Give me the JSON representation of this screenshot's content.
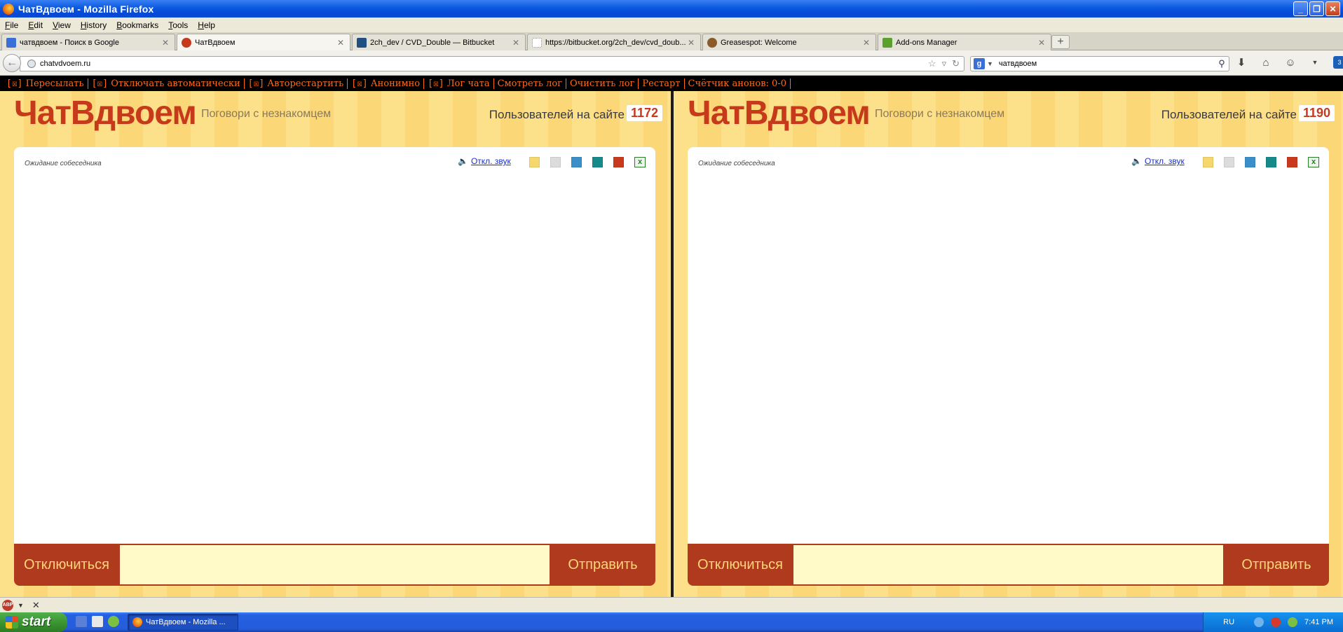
{
  "window": {
    "title": "ЧатВдвоем - Mozilla Firefox"
  },
  "menu": [
    "File",
    "Edit",
    "View",
    "History",
    "Bookmarks",
    "Tools",
    "Help"
  ],
  "tabs": [
    {
      "label": "чатвдвоем - Поиск в Google",
      "icon_color": "#3b6fd8",
      "active": false
    },
    {
      "label": "ЧатВдвоем",
      "icon_color": "#c6391b",
      "active": true
    },
    {
      "label": "2ch_dev / CVD_Double — Bitbucket",
      "icon_color": "#205081",
      "active": false
    },
    {
      "label": "https://bitbucket.org/2ch_dev/cvd_doub...",
      "icon_color": "#cccccc",
      "active": false
    },
    {
      "label": "Greasespot: Welcome",
      "icon_color": "#8a5a2b",
      "active": false
    },
    {
      "label": "Add-ons Manager",
      "icon_color": "#5aa02c",
      "active": false
    }
  ],
  "nav": {
    "url": "chatvdvoem.ru",
    "search_engine": "g",
    "search_text": "чатвдвоем",
    "badge": "3"
  },
  "scriptbar": {
    "checkbox_glyph": "[☒]",
    "items": [
      {
        "label": "Пересылать",
        "checkbox": true
      },
      {
        "label": "Отключать автоматически",
        "checkbox": true
      },
      {
        "label": "Авторестартить",
        "checkbox": true
      },
      {
        "label": "Анонимно",
        "checkbox": true
      },
      {
        "label": "Лог чата",
        "checkbox": true
      },
      {
        "label": "Смотреть лог",
        "checkbox": false
      },
      {
        "label": "Очистить лог",
        "checkbox": false
      },
      {
        "label": "Рестарт",
        "checkbox": false
      },
      {
        "label": "Счётчик анонов: 0-0",
        "checkbox": false
      }
    ]
  },
  "panes": [
    {
      "logo": "ЧатВдвоем",
      "tagline": "Поговори с незнакомцем",
      "online_label": "Пользователей на сайте",
      "online_count": "1172",
      "status": "Ожидание собеседника",
      "sound_link": "Откл. звук",
      "disconnect": "Отключиться",
      "send": "Отправить",
      "message_value": ""
    },
    {
      "logo": "ЧатВдвоем",
      "tagline": "Поговори с незнакомцем",
      "online_label": "Пользователей на сайте",
      "online_count": "1190",
      "status": "Ожидание собеседника",
      "sound_link": "Откл. звук",
      "disconnect": "Отключиться",
      "send": "Отправить",
      "message_value": ""
    }
  ],
  "theme_swatches": [
    "#f5d76e",
    "#dcdcdc",
    "#3a8fc8",
    "#168a8a",
    "#c9391b"
  ],
  "addonbar": {
    "abp_label": "ABP"
  },
  "taskbar": {
    "start": "start",
    "task_label": "ЧатВдвоем - Mozilla ...",
    "lang": "RU",
    "clock": "7:41 PM"
  }
}
